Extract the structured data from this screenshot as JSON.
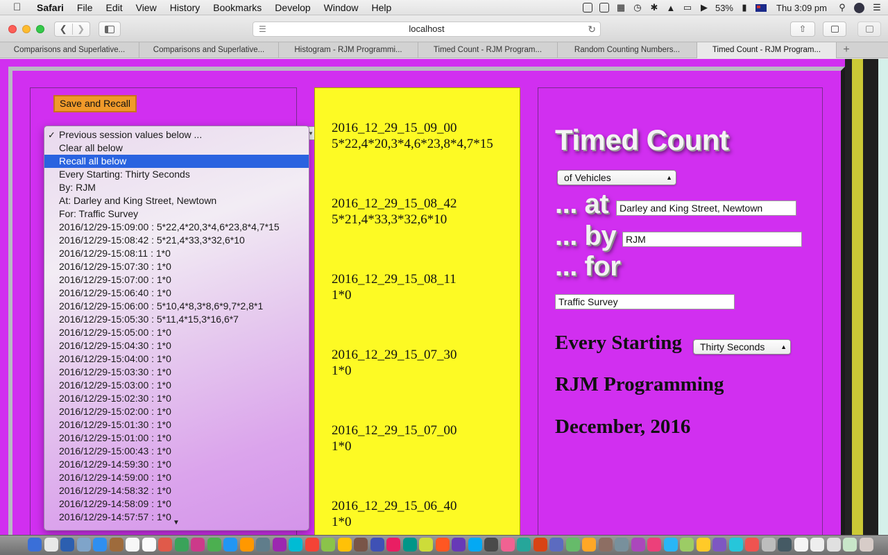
{
  "menubar": {
    "app_name": "Safari",
    "menus": [
      "File",
      "Edit",
      "View",
      "History",
      "Bookmarks",
      "Develop",
      "Window",
      "Help"
    ],
    "battery": "53%",
    "clock": "Thu 3:09 pm"
  },
  "browser": {
    "url": "localhost",
    "tabs": [
      {
        "label": "Comparisons and Superlative..."
      },
      {
        "label": "Comparisons and Superlative..."
      },
      {
        "label": "Histogram - RJM Programmi..."
      },
      {
        "label": "Timed Count - RJM Program..."
      },
      {
        "label": "Random Counting Numbers..."
      },
      {
        "label": "Timed Count - RJM Program..."
      }
    ],
    "new_tab": "+"
  },
  "page": {
    "save_button": "Save and Recall",
    "dropdown": {
      "items": [
        "Previous session values below ...",
        "Clear all below",
        "Recall all below",
        "Every Starting: Thirty Seconds",
        "By: RJM",
        "At: Darley and King Street, Newtown",
        "For: Traffic Survey",
        "2016/12/29-15:09:00 : 5*22,4*20,3*4,6*23,8*4,7*15",
        "2016/12/29-15:08:42 : 5*21,4*33,3*32,6*10",
        "2016/12/29-15:08:11 : 1*0",
        "2016/12/29-15:07:30 : 1*0",
        "2016/12/29-15:07:00 : 1*0",
        "2016/12/29-15:06:40 : 1*0",
        "2016/12/29-15:06:00 : 5*10,4*8,3*8,6*9,7*2,8*1",
        "2016/12/29-15:05:30 : 5*11,4*15,3*16,6*7",
        "2016/12/29-15:05:00 : 1*0",
        "2016/12/29-15:04:30 : 1*0",
        "2016/12/29-15:04:00 : 1*0",
        "2016/12/29-15:03:30 : 1*0",
        "2016/12/29-15:03:00 : 1*0",
        "2016/12/29-15:02:30 : 1*0",
        "2016/12/29-15:02:00 : 1*0",
        "2016/12/29-15:01:30 : 1*0",
        "2016/12/29-15:01:00 : 1*0",
        "2016/12/29-15:00:43 : 1*0",
        "2016/12/29-14:59:30 : 1*0",
        "2016/12/29-14:59:00 : 1*0",
        "2016/12/29-14:58:32 : 1*0",
        "2016/12/29-14:58:09 : 1*0",
        "2016/12/29-14:57:57 : 1*0"
      ],
      "checked_index": 0,
      "selected_index": 2
    },
    "entries": [
      {
        "stamp": "2016_12_29_15_09_00",
        "counts": "5*22,4*20,3*4,6*23,8*4,7*15"
      },
      {
        "stamp": "2016_12_29_15_08_42",
        "counts": "5*21,4*33,3*32,6*10"
      },
      {
        "stamp": "2016_12_29_15_08_11",
        "counts": "1*0"
      },
      {
        "stamp": "2016_12_29_15_07_30",
        "counts": "1*0"
      },
      {
        "stamp": "2016_12_29_15_07_00",
        "counts": "1*0"
      },
      {
        "stamp": "2016_12_29_15_06_40",
        "counts": "1*0"
      }
    ],
    "title": "Timed Count",
    "of_select": "of Vehicles",
    "at_label": "... at",
    "at_value": "Darley and King Street, Newtown",
    "by_label": "... by",
    "by_value": "RJM",
    "for_label": "... for",
    "for_value": "Traffic Survey",
    "every_label": "Every Starting",
    "every_select": "Thirty Seconds",
    "author": "RJM Programming",
    "date": "December, 2016"
  },
  "colors": {
    "page_bg": "#d12ff0",
    "column_yellow": "#fdfa24",
    "save_button": "#f09a2a",
    "selected_item": "#2a63e0"
  }
}
